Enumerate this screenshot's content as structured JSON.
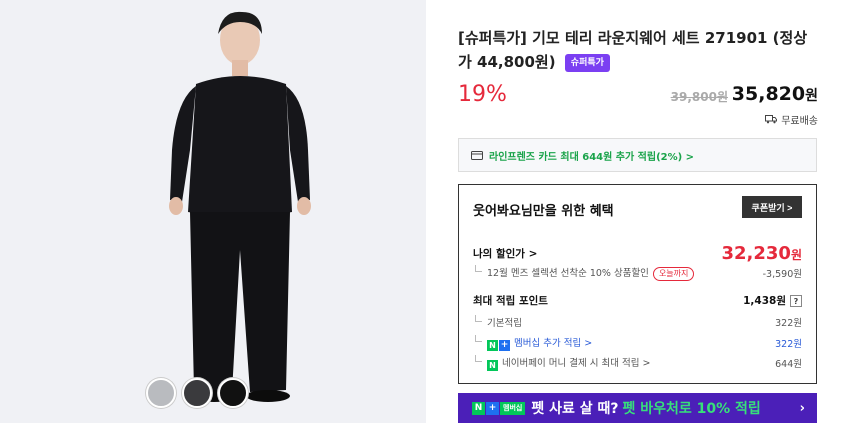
{
  "product": {
    "title": "[슈퍼특가] 기모 테리 라운지웨어 세트 271901 (정상가 44,800원)",
    "badge": "슈퍼특가",
    "discount": "19%",
    "original_price": "39,800원",
    "price": "35,820",
    "price_unit": "원",
    "shipping": "무료배송"
  },
  "swatches": [
    {
      "name": "gray",
      "color": "#b9bbbf"
    },
    {
      "name": "charcoal",
      "color": "#3a3a3d"
    },
    {
      "name": "black",
      "color": "#111111"
    }
  ],
  "card_promo": "라인프렌즈 카드 최대 644원 추가 적립(2%) >",
  "benefit": {
    "title": "웃어봐요님만을 위한 혜택",
    "coupon_button": "쿠폰받기 >",
    "my_price_label": "나의 할인가 >",
    "my_price_value": "32,230",
    "my_price_unit": "원",
    "coupon_desc": "12월 멘즈 셀렉션 선착순 10% 상품할인",
    "coupon_tag": "오늘까지",
    "coupon_value": "-3,590원",
    "max_points_label": "최대 적립 포인트",
    "max_points_value": "1,438원",
    "help_mark": "?",
    "basic_label": "기본적립",
    "basic_value": "322원",
    "membership_label": "멤버십 추가 적립 >",
    "membership_value": "322원",
    "npay_label": "네이버페이 머니 결제 시 최대 적립 >",
    "npay_value": "644원"
  },
  "banner": {
    "logo_n": "N",
    "logo_plus": "+",
    "logo_membership": "멤버십",
    "text": "펫 사료 살 때?",
    "highlight": "펫 바우처로 10% 적립",
    "chevron": "›"
  },
  "icons": {
    "card": "card-icon",
    "truck": "truck-icon",
    "naver_n": "N",
    "naver_plus": "+"
  }
}
